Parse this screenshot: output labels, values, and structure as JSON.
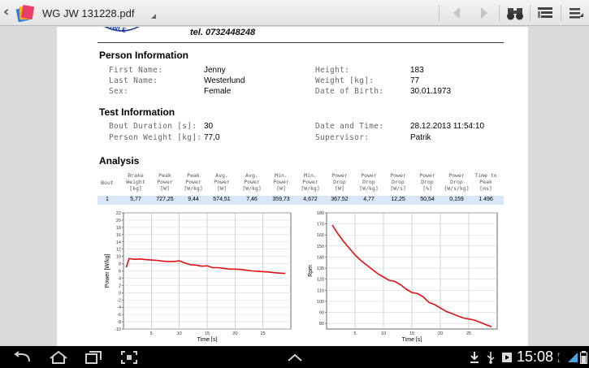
{
  "topbar": {
    "title": "WG JW 131228.pdf"
  },
  "page": {
    "phone": "tel. 0732448248",
    "sections": {
      "person": "Person Information",
      "test": "Test Information",
      "analysis": "Analysis"
    },
    "person": {
      "first_name_label": "First Name:",
      "first_name": "Jenny",
      "last_name_label": "Last Name:",
      "last_name": "Westerlund",
      "sex_label": "Sex:",
      "sex": "Female",
      "height_label": "Height:",
      "height": "183",
      "weight_label": "Weight [kg]:",
      "weight": "77",
      "dob_label": "Date of Birth:",
      "dob": "30.01.1973"
    },
    "test": {
      "duration_label": "Bout Duration [s]:",
      "duration": "30",
      "person_weight_label": "Person Weight [kg]:",
      "person_weight": "77,0",
      "datetime_label": "Date and Time:",
      "datetime": "28.12.2013 11:54:10",
      "supervisor_label": "Supervisor:",
      "supervisor": "Patrik"
    },
    "analysis": {
      "headers": [
        [
          "Bout"
        ],
        [
          "Brake",
          "Weight",
          "[kg]"
        ],
        [
          "Peak",
          "Power",
          "[W]"
        ],
        [
          "Peak",
          "Power",
          "[W/kg]"
        ],
        [
          "Avg.",
          "Power",
          "[W]"
        ],
        [
          "Avg.",
          "Power",
          "[W/kg]"
        ],
        [
          "Min.",
          "Power",
          "[W]"
        ],
        [
          "Min.",
          "Power",
          "[W/kg]"
        ],
        [
          "Power",
          "Drop",
          "[W]"
        ],
        [
          "Power",
          "Drop",
          "[W/kg]"
        ],
        [
          "Power",
          "Drop",
          "[W/s]"
        ],
        [
          "Power",
          "Drop",
          "[%]"
        ],
        [
          "Power",
          "Drop",
          "[W/s/kg]"
        ],
        [
          "Time to",
          "Peak",
          "[ms]"
        ]
      ],
      "row": [
        "1",
        "5,77",
        "727,25",
        "9,44",
        "574,51",
        "7,46",
        "359,73",
        "4,672",
        "367,52",
        "4,77",
        "12,25",
        "50,54",
        "0,159",
        "1 496"
      ]
    }
  },
  "chart_data": [
    {
      "type": "line",
      "title": "",
      "xlabel": "Time [s]",
      "ylabel": "Power [W/kg]",
      "xlim": [
        0,
        30
      ],
      "ylim": [
        -10,
        22
      ],
      "xticks": [
        5,
        10,
        15,
        20,
        25
      ],
      "yticks": [
        -10,
        -8,
        -6,
        -4,
        -2,
        0,
        2,
        4,
        6,
        8,
        10,
        12,
        14,
        16,
        18,
        20,
        22
      ],
      "grid": true,
      "color": "#e01010",
      "series": [
        {
          "x": [
            0.5,
            1,
            2,
            3,
            4,
            5,
            6,
            7,
            8,
            9,
            10,
            11,
            12,
            13,
            14,
            15,
            16,
            17,
            18,
            19,
            20,
            21,
            22,
            23,
            24,
            25,
            26,
            27,
            28,
            29
          ],
          "y": [
            7.0,
            9.4,
            9.2,
            9.3,
            9.1,
            9.0,
            8.9,
            8.7,
            8.6,
            8.6,
            8.8,
            8.2,
            7.7,
            7.6,
            7.3,
            7.4,
            6.9,
            6.9,
            6.7,
            6.5,
            6.5,
            6.4,
            6.2,
            6.0,
            5.9,
            5.8,
            5.7,
            5.5,
            5.4,
            5.3
          ]
        }
      ]
    },
    {
      "type": "line",
      "title": "",
      "xlabel": "Time [s]",
      "ylabel": "Rpm",
      "xlim": [
        0,
        30
      ],
      "ylim": [
        75,
        180
      ],
      "xticks": [
        5,
        10,
        15,
        20,
        25
      ],
      "yticks": [
        80,
        90,
        100,
        110,
        120,
        130,
        140,
        150,
        160,
        170,
        180
      ],
      "grid": true,
      "color": "#e01010",
      "series": [
        {
          "x": [
            1,
            2,
            3,
            4,
            5,
            6,
            7,
            8,
            9,
            10,
            11,
            12,
            13,
            14,
            15,
            16,
            17,
            18,
            19,
            20,
            21,
            22,
            23,
            24,
            25,
            26,
            27,
            28,
            29
          ],
          "y": [
            169,
            161,
            154,
            148,
            142,
            137,
            133,
            129,
            125,
            122,
            119,
            118,
            115,
            111,
            108,
            107,
            104,
            99,
            97,
            94,
            91,
            89,
            87,
            85,
            84,
            83,
            81,
            79,
            77
          ]
        }
      ]
    }
  ],
  "sysbar": {
    "clock": "15:08"
  }
}
